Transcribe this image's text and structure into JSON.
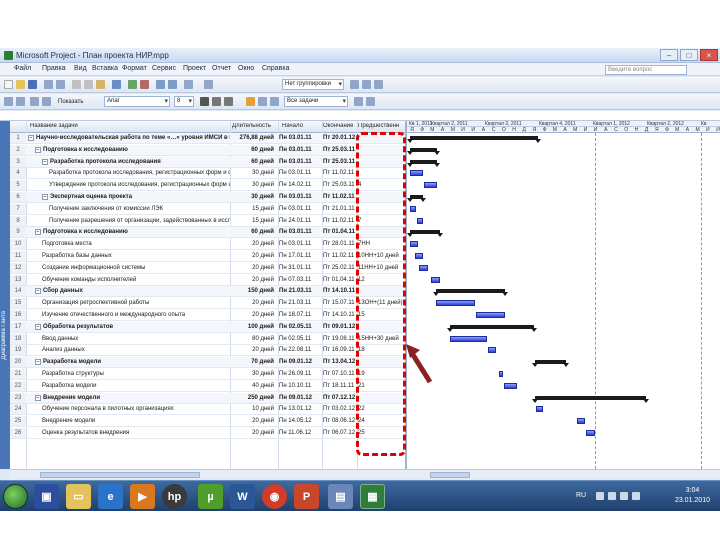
{
  "window": {
    "title": "Microsoft Project - План проекта НИР.mpp"
  },
  "menu": [
    "Файл",
    "Правка",
    "Вид",
    "Вставка",
    "Формат",
    "Сервис",
    "Проект",
    "Отчет",
    "Окно",
    "Справка"
  ],
  "help_placeholder": "Введите вопрос",
  "toolbar": {
    "group_combo": "Нет группировки",
    "show_label": "Показать",
    "font_combo": "Arial",
    "size_combo": "8",
    "filter_combo": "Все задачи"
  },
  "view_bar_label": "Диаграмма Ганта",
  "columns": {
    "id": "",
    "name": "Название задачи",
    "duration": "Длительность",
    "start": "Начало",
    "finish": "Окончание",
    "predecessors": "Предшественн"
  },
  "rows": [
    {
      "id": "1",
      "name": "Научно-исследовательская работа по теме «…» уровня ИМСИ в Республике Казахстан",
      "duration": "276,88 дней",
      "start": "Пн 03.01.11",
      "finish": "Пт 20.01.12",
      "pred": "",
      "level": 0,
      "summary": true
    },
    {
      "id": "2",
      "name": "Подготовка к исследованию",
      "duration": "60 дней",
      "start": "Пн 03.01.11",
      "finish": "Пт 25.03.11",
      "pred": "",
      "level": 1,
      "summary": true
    },
    {
      "id": "3",
      "name": "Разработка протокола исследования",
      "duration": "60 дней",
      "start": "Пн 03.01.11",
      "finish": "Пт 25.03.11",
      "pred": "",
      "level": 2,
      "summary": true
    },
    {
      "id": "4",
      "name": "Разработка протокола исследования, регистрационных форм и форм информированного согласия",
      "duration": "30 дней",
      "start": "Пн 03.01.11",
      "finish": "Пт 11.02.11",
      "pred": "",
      "level": 3,
      "summary": false
    },
    {
      "id": "5",
      "name": "Утверждение протокола исследования, регистрационных форм и форм информированного согласия",
      "duration": "30 дней",
      "start": "Пн 14.02.11",
      "finish": "Пт 25.03.11",
      "pred": "4",
      "level": 3,
      "summary": false
    },
    {
      "id": "6",
      "name": "Экспертная оценка проекта",
      "duration": "30 дней",
      "start": "Пн 03.01.11",
      "finish": "Пт 11.02.11",
      "pred": "",
      "level": 2,
      "summary": true
    },
    {
      "id": "7",
      "name": "Получение заключения от комиссии ЛЭК",
      "duration": "15 дней",
      "start": "Пн 03.01.11",
      "finish": "Пт 21.01.11",
      "pred": "",
      "level": 3,
      "summary": false
    },
    {
      "id": "8",
      "name": "Получение разрешения от организации, задействованных в исследовании",
      "duration": "15 дней",
      "start": "Пн 24.01.11",
      "finish": "Пт 11.02.11",
      "pred": "7",
      "level": 3,
      "summary": false
    },
    {
      "id": "9",
      "name": "Подготовка к исследованию",
      "duration": "60 дней",
      "start": "Пн 03.01.11",
      "finish": "Пт 01.04.11",
      "pred": "",
      "level": 1,
      "summary": true
    },
    {
      "id": "10",
      "name": "Подготовка места",
      "duration": "20 дней",
      "start": "Пн 03.01.11",
      "finish": "Пт 28.01.11",
      "pred": "7НН",
      "level": 2,
      "summary": false
    },
    {
      "id": "11",
      "name": "Разработка базы данных",
      "duration": "20 дней",
      "start": "Пн 17.01.11",
      "finish": "Пт 11.02.11",
      "pred": "10НН+10 дней",
      "level": 2,
      "summary": false
    },
    {
      "id": "12",
      "name": "Создание информационной системы",
      "duration": "20 дней",
      "start": "Пн 31.01.11",
      "finish": "Пт 25.02.11",
      "pred": "11НН+10 дней",
      "level": 2,
      "summary": false
    },
    {
      "id": "13",
      "name": "Обучение команды исполнителей",
      "duration": "20 дней",
      "start": "Пн 07.03.11",
      "finish": "Пт 01.04.11",
      "pred": "12",
      "level": 2,
      "summary": false
    },
    {
      "id": "14",
      "name": "Сбор данных",
      "duration": "150 дней",
      "start": "Пн 21.03.11",
      "finish": "Пт 14.10.11",
      "pred": "",
      "level": 1,
      "summary": true
    },
    {
      "id": "15",
      "name": "Организация ретроспективной работы",
      "duration": "20 дней",
      "start": "Пн 21.03.11",
      "finish": "Пт 15.07.11",
      "pred": "13ОН+(11 дней)",
      "level": 2,
      "summary": false
    },
    {
      "id": "16",
      "name": "Изучение отечественного и международного опыта",
      "duration": "20 дней",
      "start": "Пн 18.07.11",
      "finish": "Пт 14.10.11",
      "pred": "15",
      "level": 2,
      "summary": false
    },
    {
      "id": "17",
      "name": "Обработка результатов",
      "duration": "100 дней",
      "start": "Пн 02.05.11",
      "finish": "Пт 09.01.12",
      "pred": "",
      "level": 1,
      "summary": true
    },
    {
      "id": "18",
      "name": "Ввод данных",
      "duration": "80 дней",
      "start": "Пн 02.05.11",
      "finish": "Пт 19.08.11",
      "pred": "15НН+30 дней",
      "level": 2,
      "summary": false
    },
    {
      "id": "19",
      "name": "Анализ данных",
      "duration": "20 дней",
      "start": "Пн 22.08.11",
      "finish": "Пт 16.09.11",
      "pred": "18",
      "level": 2,
      "summary": false
    },
    {
      "id": "20",
      "name": "Разработка модели",
      "duration": "70 дней",
      "start": "Пн 09.01.12",
      "finish": "Пт 13.04.12",
      "pred": "",
      "level": 1,
      "summary": true
    },
    {
      "id": "21",
      "name": "Разработка структуры",
      "duration": "30 дней",
      "start": "Пн 26.09.11",
      "finish": "Пт 07.10.11",
      "pred": "19",
      "level": 2,
      "summary": false
    },
    {
      "id": "22",
      "name": "Разработка модели",
      "duration": "40 дней",
      "start": "Пн 10.10.11",
      "finish": "Пт 18.11.11",
      "pred": "21",
      "level": 2,
      "summary": false
    },
    {
      "id": "23",
      "name": "Внедрение модели",
      "duration": "250 дней",
      "start": "Пн 09.01.12",
      "finish": "Пт 07.12.12",
      "pred": "",
      "level": 1,
      "summary": true
    },
    {
      "id": "24",
      "name": "Обучение персонала в пилотных организациях",
      "duration": "10 дней",
      "start": "Пн 13.01.12",
      "finish": "Пт 03.02.12",
      "pred": "22",
      "level": 2,
      "summary": false
    },
    {
      "id": "25",
      "name": "Внедрение модели",
      "duration": "20 дней",
      "start": "Пн 14.05.12",
      "finish": "Пт 08.06.12",
      "pred": "24",
      "level": 2,
      "summary": false
    },
    {
      "id": "26",
      "name": "Оценка результатов внедрения",
      "duration": "20 дней",
      "start": "Пн 11.06.12",
      "finish": "Пт 06.07.12",
      "pred": "25",
      "level": 2,
      "summary": false
    }
  ],
  "gantt": {
    "periods": [
      "Кв 1, 2011",
      "Квартал 2, 2011",
      "Квартал 3, 2011",
      "Квартал 4, 2011",
      "Квартал 1, 2012",
      "Квартал 2, 2012",
      "Кв"
    ],
    "months": [
      "Я",
      "Ф",
      "М",
      "А",
      "М",
      "И",
      "И",
      "А",
      "С",
      "О",
      "Н",
      "Д",
      "Я",
      "Ф",
      "М",
      "А",
      "М",
      "И",
      "И",
      "А",
      "С",
      "О",
      "Н",
      "Д",
      "Я",
      "Ф",
      "М",
      "А",
      "М",
      "И",
      "И"
    ]
  },
  "taskbar": {
    "lang": "RU",
    "time": "3:04",
    "date": "23.01.2010",
    "apps": [
      "save",
      "folder",
      "ie",
      "media",
      "hp",
      "utorrent",
      "word",
      "chrome",
      "powerpoint",
      "book",
      "project"
    ]
  }
}
